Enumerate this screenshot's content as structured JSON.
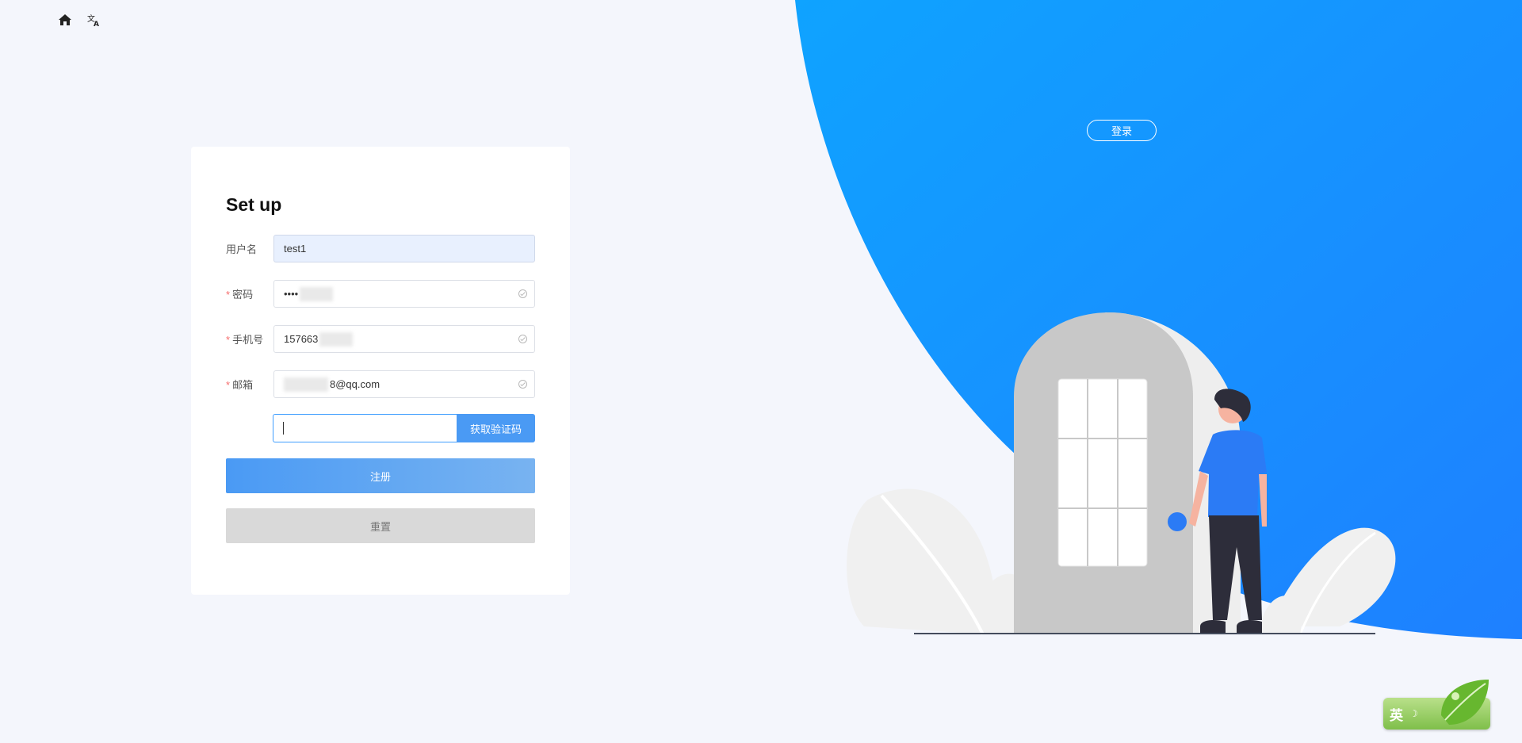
{
  "toolbar": {
    "home_icon": "home-icon",
    "translate_icon": "translate-icon"
  },
  "hero": {
    "login_label": "登录",
    "accent_color": "#1a8cff"
  },
  "form": {
    "title": "Set up",
    "username": {
      "label": "用户名",
      "value": "test1",
      "required": false
    },
    "password": {
      "label": "密码",
      "value": "••••",
      "required": true
    },
    "phone": {
      "label": "手机号",
      "value": "157663",
      "required": true
    },
    "email": {
      "label": "邮箱",
      "value": "8@qq.com",
      "required": true
    },
    "code": {
      "value": "",
      "button_label": "获取验证码"
    },
    "submit_label": "注册",
    "reset_label": "重置"
  },
  "ime": {
    "label": "英"
  }
}
